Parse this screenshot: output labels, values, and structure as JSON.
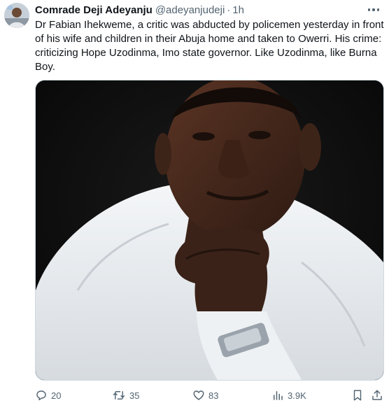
{
  "tweet": {
    "author_name": "Comrade Deji Adeyanju",
    "author_handle": "@adeyanjudeji",
    "separator": "·",
    "time": "1h",
    "text": "Dr Fabian Ihekweme, a critic was abducted by policemen yesterday in front of his wife and children in their Abuja home and taken to Owerri. His crime: criticizing Hope Uzodinma, Imo state governor. Like Uzodinma, like Burna Boy."
  },
  "actions": {
    "replies": "20",
    "reposts": "35",
    "likes": "83",
    "views": "3.9K"
  },
  "icons": {
    "reply": "reply-icon",
    "repost": "repost-icon",
    "like": "heart-icon",
    "views": "views-icon",
    "bookmark": "bookmark-icon",
    "share": "share-icon",
    "more": "more-icon"
  },
  "colors": {
    "text": "#0f1419",
    "secondary": "#536471",
    "border": "#cfd9de"
  }
}
